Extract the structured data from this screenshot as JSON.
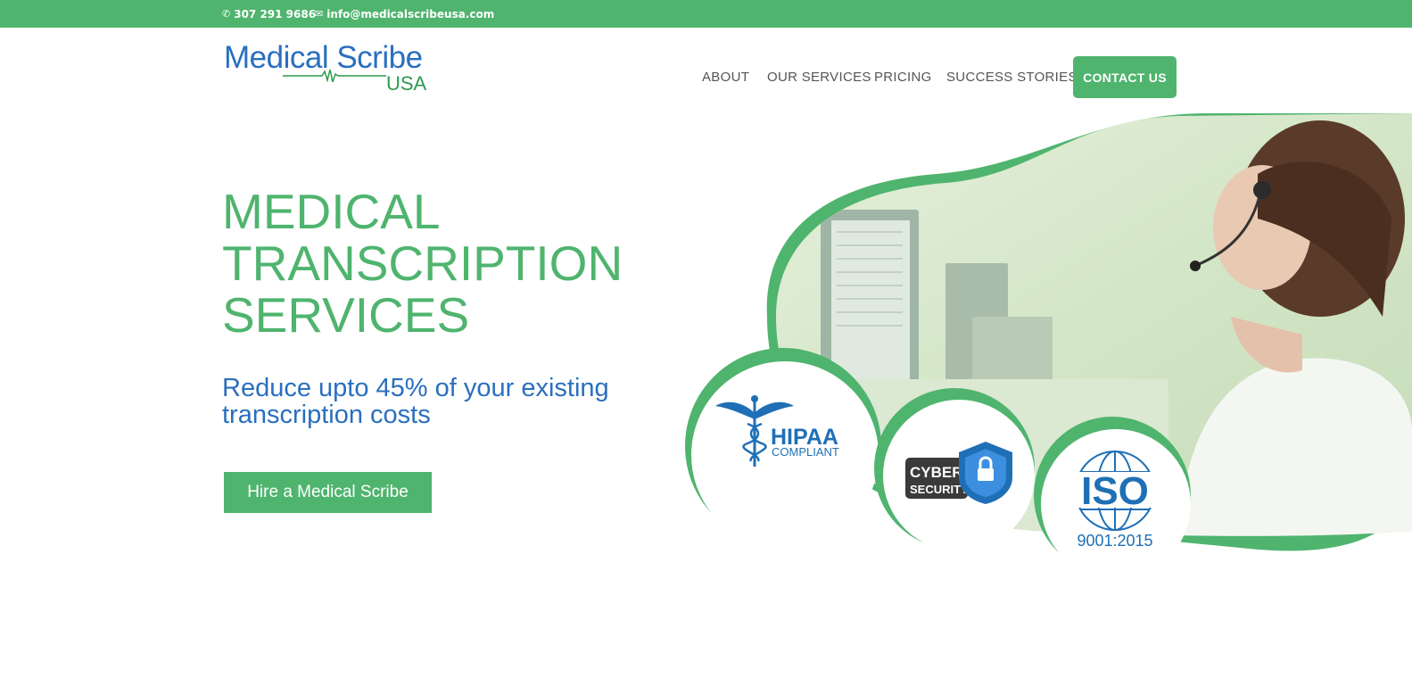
{
  "topbar": {
    "phone": "307 291 9686",
    "email": "info@medicalscribeusa.com",
    "phone_icon": "phone-icon",
    "email_icon": "envelope-icon"
  },
  "logo": {
    "line1": "Medical Scribe",
    "line2": "USA"
  },
  "nav": {
    "items": [
      "ABOUT",
      "OUR SERVICES",
      "PRICING",
      "SUCCESS STORIES"
    ],
    "cta": "CONTACT US"
  },
  "hero": {
    "title_lines": [
      "MEDICAL",
      "TRANSCRIPTION",
      "SERVICES"
    ],
    "subtitle_lines": [
      "Reduce upto 45% of your existing",
      "transcription costs"
    ],
    "button": "Hire a Medical Scribe"
  },
  "badges": {
    "hipaa": {
      "title": "HIPAA",
      "sub": "COMPLIANT"
    },
    "cyber": {
      "line1": "CYBER",
      "line2": "SECURITY"
    },
    "iso": {
      "title": "ISO",
      "sub": "9001:2015"
    }
  },
  "colors": {
    "brand_green": "#4fb46e",
    "brand_blue": "#2a6fbe"
  }
}
